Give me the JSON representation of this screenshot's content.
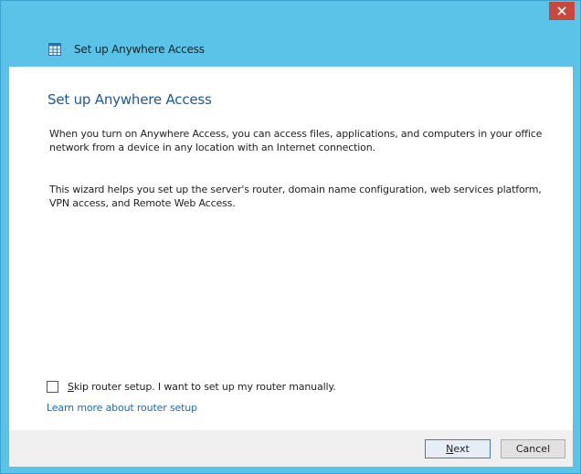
{
  "window": {
    "title": "Set up Anywhere Access",
    "icon": "table-app-icon",
    "close_icon": "close-icon"
  },
  "main": {
    "heading": "Set up Anywhere Access",
    "paragraph_1": "When you turn on Anywhere Access, you can access files, applications, and computers in your office network from a device in any location with an Internet connection.",
    "paragraph_2": "This wizard helps you set up the server's router, domain name configuration, web services platform, VPN access, and Remote Web Access.",
    "skip_router_checkbox": {
      "checked": false,
      "label_mnemonic": "S",
      "label_rest": "kip router setup. I want to set up my router manually."
    },
    "learn_more_link": "Learn more about router setup"
  },
  "footer": {
    "next_mnemonic": "N",
    "next_rest": "ext",
    "cancel_label": "Cancel"
  },
  "colors": {
    "frame": "#5bc3e7",
    "close": "#c9483d",
    "heading": "#1a5aa1",
    "link": "#1a6ab8"
  }
}
